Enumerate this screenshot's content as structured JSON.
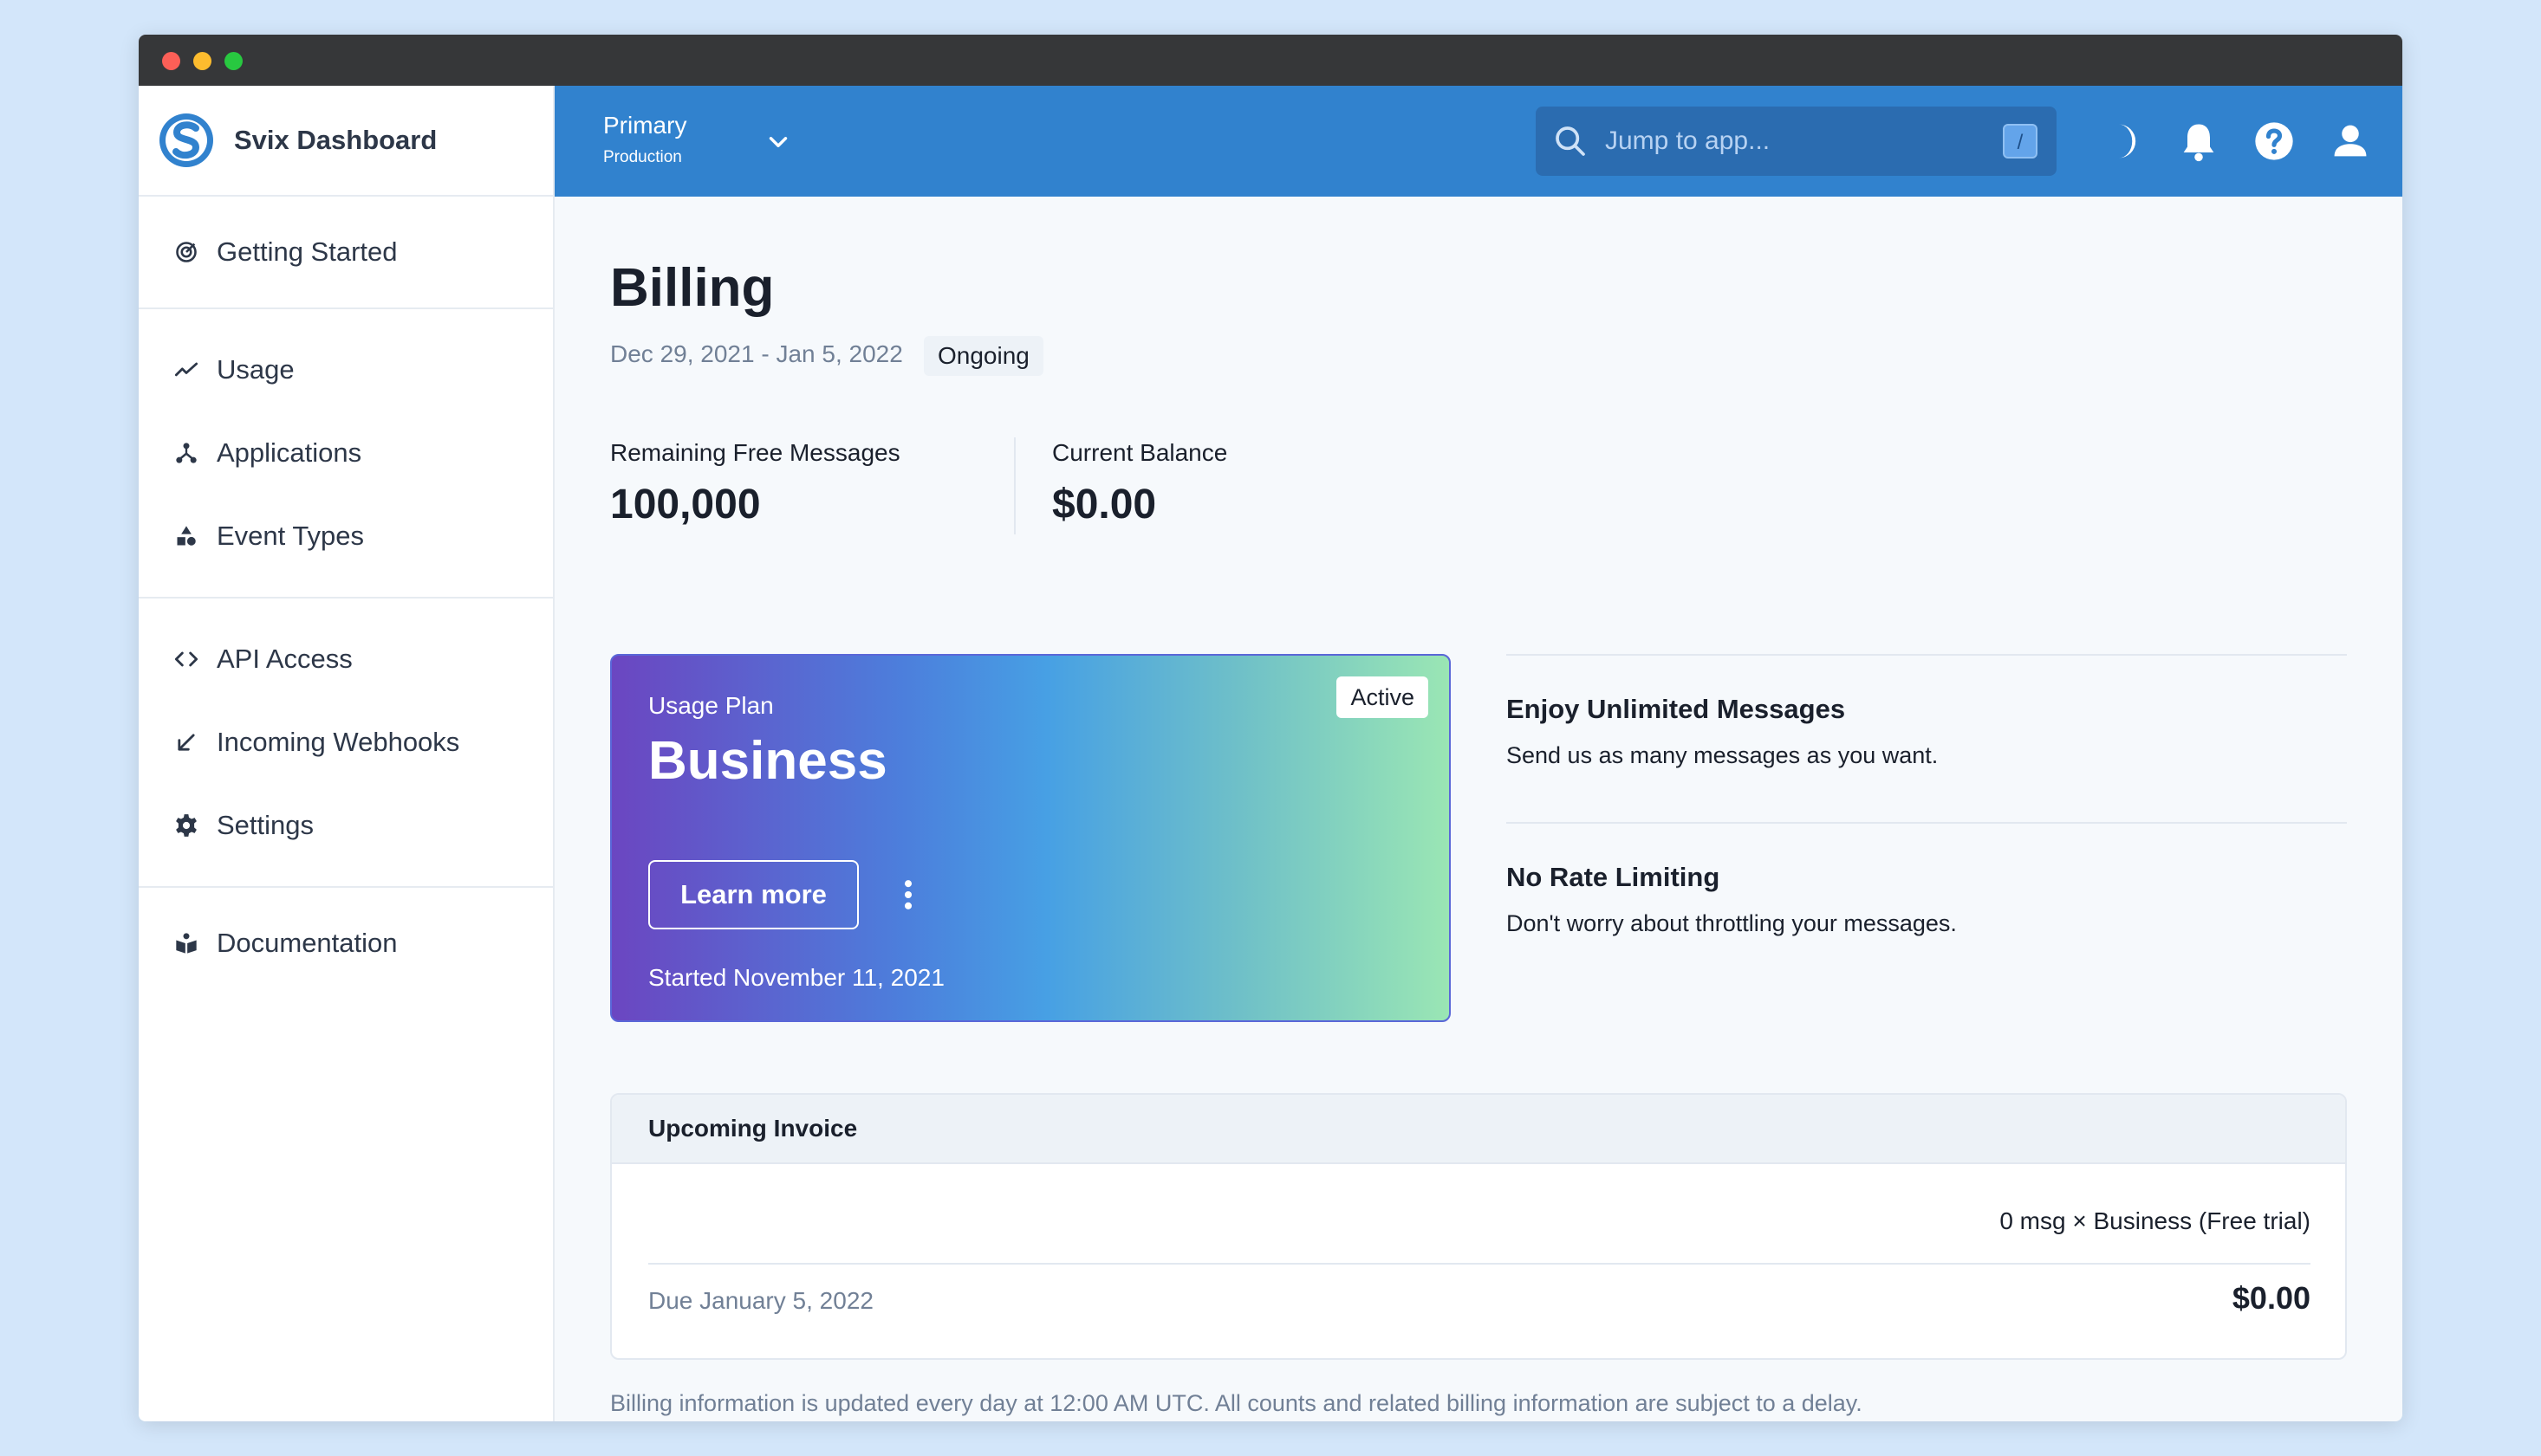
{
  "sidebar": {
    "brand": "Svix Dashboard",
    "groups": [
      [
        {
          "label": "Getting Started",
          "icon": "getting-started-icon"
        }
      ],
      [
        {
          "label": "Usage",
          "icon": "usage-chart-icon"
        },
        {
          "label": "Applications",
          "icon": "applications-icon"
        },
        {
          "label": "Event Types",
          "icon": "event-types-icon"
        }
      ],
      [
        {
          "label": "API Access",
          "icon": "code-icon"
        },
        {
          "label": "Incoming Webhooks",
          "icon": "incoming-arrow-icon"
        },
        {
          "label": "Settings",
          "icon": "gear-icon"
        }
      ],
      [
        {
          "label": "Documentation",
          "icon": "book-icon"
        }
      ]
    ]
  },
  "topbar": {
    "env_name": "Primary",
    "env_sub": "Production",
    "search_placeholder": "Jump to app...",
    "search_shortcut": "/"
  },
  "billing": {
    "title": "Billing",
    "date_range": "Dec 29, 2021 - Jan 5, 2022",
    "status": "Ongoing",
    "stats": [
      {
        "label": "Remaining Free Messages",
        "value": "100,000"
      },
      {
        "label": "Current Balance",
        "value": "$0.00"
      }
    ],
    "plan": {
      "label": "Usage Plan",
      "name": "Business",
      "badge": "Active",
      "button": "Learn more",
      "started": "Started November 11, 2021"
    },
    "features": [
      {
        "title": "Enjoy Unlimited Messages",
        "desc": "Send us as many messages as you want."
      },
      {
        "title": "No Rate Limiting",
        "desc": "Don't worry about throttling your messages."
      }
    ],
    "invoice": {
      "title": "Upcoming Invoice",
      "line": "0 msg × Business (Free trial)",
      "due": "Due January 5, 2022",
      "total": "$0.00"
    },
    "footnote": "Billing information is updated every day at 12:00 AM UTC. All counts and related billing information are subject to a delay."
  },
  "colors": {
    "topbar": "#3182ce",
    "brand": "#3182ce"
  }
}
